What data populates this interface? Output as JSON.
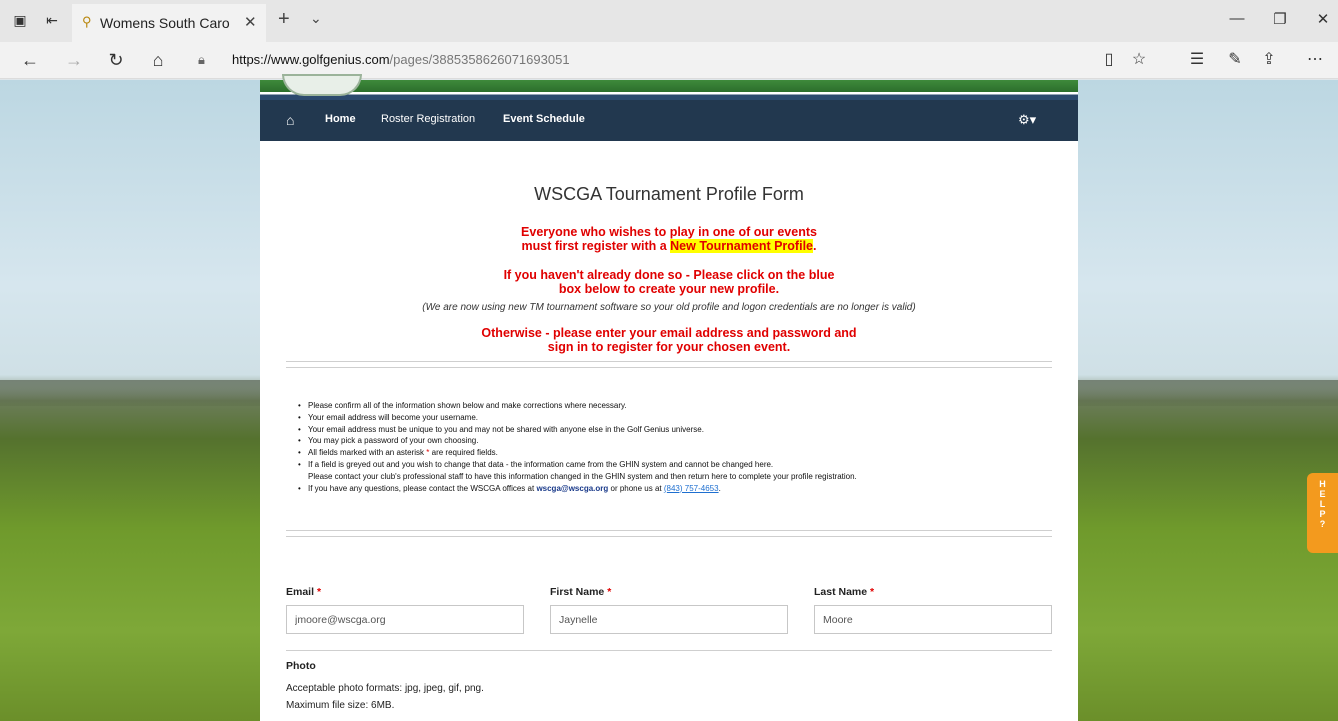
{
  "browser": {
    "tab_title": "Womens South Carolina",
    "tab_close": "✕",
    "new_tab": "+",
    "tab_list": "⌄",
    "url_host": "https://www.golfgenius.com",
    "url_path": "/pages/3885358626071693051",
    "icons": [
      "tab-manager-icon",
      "set-aside-tabs-icon",
      "favicon-icon",
      "back-icon",
      "forward-icon",
      "refresh-icon",
      "home-icon",
      "lock-icon",
      "reading-view-icon",
      "favorite-star-icon",
      "favorites-list-icon",
      "pen-icon",
      "share-icon",
      "more-icon",
      "minimize-icon",
      "restore-icon",
      "close-window-icon"
    ]
  },
  "site": {
    "nav": {
      "home": "Home",
      "roster": "Roster Registration",
      "schedule": "Event Schedule"
    },
    "form_title": "WSCGA Tournament Profile Form",
    "red_1a": "Everyone who wishes to play in one of our events",
    "red_1b_pre": "must first register with a ",
    "red_1b_hl": "New Tournament Profile",
    "red_1b_post": ".",
    "red_2a": "If you haven't already done so - Please click on the blue",
    "red_2b": "box below to create your new profile.",
    "note": "(We are now using new TM tournament software so your old profile and logon credentials are no longer is valid)",
    "red_3a": "Otherwise - please enter your email address and password and",
    "red_3b": "sign in to register for your chosen event.",
    "bullets": {
      "b1": "Please confirm all of the information shown below and make corrections where necessary.",
      "b2": "Your email address will become your username.",
      "b3": "Your email address must be unique to you and may not be shared with anyone else in the Golf Genius universe.",
      "b4": "You may pick a password of your own choosing.",
      "b5_pre": "All fields marked with an asterisk ",
      "b5_ast": "*",
      "b5_post": " are required fields.",
      "b6a": "If a field is greyed out and you wish to change that data - the information came from the GHIN system and cannot be changed here.",
      "b6b": "Please contact your club's professional staff to have this information changed in the GHIN system and then return here to complete your profile registration.",
      "b7_pre": "If you have any questions, please contact the WSCGA offices at ",
      "b7_mail": "wscga@wscga.org",
      "b7_mid": " or phone us at ",
      "b7_phone": "(843) 757-4653",
      "b7_post": "."
    },
    "fields": {
      "email_label": "Email",
      "email_value": "jmoore@wscga.org",
      "first_label": "First Name",
      "first_value": "Jaynelle",
      "last_label": "Last Name",
      "last_value": "Moore",
      "required_mark": "*"
    },
    "photo": {
      "label": "Photo",
      "formats": "Acceptable photo formats: jpg, jpeg, gif, png.",
      "size": "Maximum file size: 6MB."
    },
    "help_tab": [
      "H",
      "E",
      "L",
      "P",
      "?"
    ]
  }
}
